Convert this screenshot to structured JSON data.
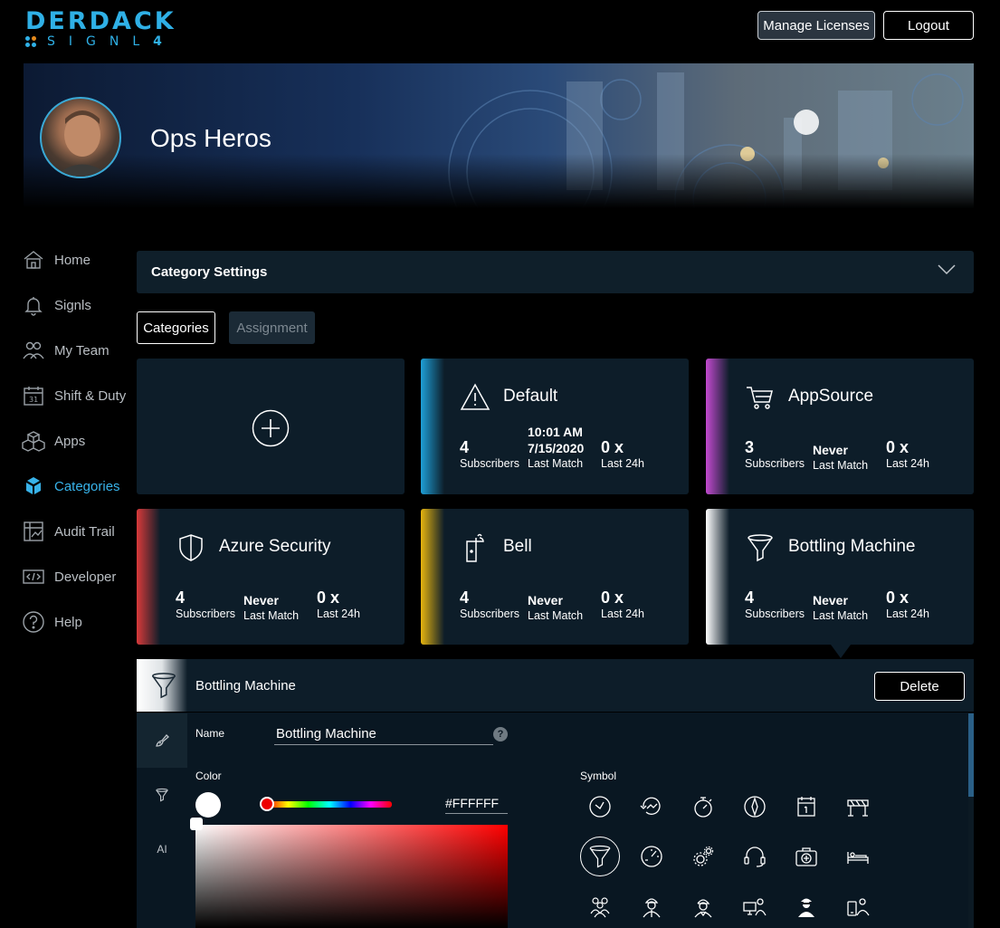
{
  "brand": {
    "name": "DERDACK",
    "product": "SIGNL",
    "version": "4",
    "accent": "#2fb0e6"
  },
  "header": {
    "manage_licenses": "Manage Licenses",
    "logout": "Logout"
  },
  "banner": {
    "team_name": "Ops Heros"
  },
  "sidebar": {
    "items": [
      {
        "label": "Home",
        "icon": "home-icon"
      },
      {
        "label": "Signls",
        "icon": "bell-icon"
      },
      {
        "label": "My Team",
        "icon": "team-icon"
      },
      {
        "label": "Shift & Duty",
        "icon": "calendar-icon"
      },
      {
        "label": "Apps",
        "icon": "cubes-icon"
      },
      {
        "label": "Categories",
        "icon": "categories-icon",
        "active": true
      },
      {
        "label": "Audit Trail",
        "icon": "audit-icon"
      },
      {
        "label": "Developer",
        "icon": "code-icon"
      },
      {
        "label": "Help",
        "icon": "help-icon"
      }
    ]
  },
  "settings": {
    "title": "Category Settings"
  },
  "tabs": {
    "categories": "Categories",
    "assignment": "Assignment"
  },
  "labels": {
    "subscribers": "Subscribers",
    "last_match": "Last Match",
    "last_24h": "Last 24h"
  },
  "cards": [
    {
      "name": "Default",
      "icon": "warning-icon",
      "color": "#1e9fd6",
      "subscribers": "4",
      "last_match": "10:01 AM\n7/15/2020",
      "last_match_time": "10:01 AM",
      "last_match_date": "7/15/2020",
      "last_24h": "0 x"
    },
    {
      "name": "AppSource",
      "icon": "cart-icon",
      "color": "#c34ad0",
      "subscribers": "3",
      "last_match": "Never",
      "last_24h": "0 x"
    },
    {
      "name": "Azure Security",
      "icon": "shield-icon",
      "color": "#d93a3a",
      "subscribers": "4",
      "last_match": "Never",
      "last_24h": "0 x"
    },
    {
      "name": "Bell",
      "icon": "doorbell-icon",
      "color": "#e6b40f",
      "subscribers": "4",
      "last_match": "Never",
      "last_24h": "0 x"
    },
    {
      "name": "Bottling Machine",
      "icon": "funnel-icon",
      "color": "#ffffff",
      "subscribers": "4",
      "last_match": "Never",
      "last_24h": "0 x"
    }
  ],
  "detail": {
    "title": "Bottling Machine",
    "delete": "Delete",
    "name_label": "Name",
    "name_value": "Bottling Machine",
    "help": "?",
    "color_label": "Color",
    "color_value": "#FFFFFF",
    "symbol_label": "Symbol",
    "side_tabs": [
      "brush-icon",
      "funnel-icon",
      "ai-icon"
    ],
    "ai_text": "AI"
  },
  "symbols": [
    "clock-icon",
    "history-icon",
    "stopwatch-icon",
    "compass-icon",
    "calendar-day-icon",
    "barrier-icon",
    "funnel-icon",
    "gauge-icon",
    "gears-icon",
    "headset-icon",
    "first-aid-icon",
    "bed-icon",
    "group-icon",
    "worker-icon",
    "engineer-icon",
    "desk-user-icon",
    "agent-icon",
    "mobile-user-icon"
  ]
}
